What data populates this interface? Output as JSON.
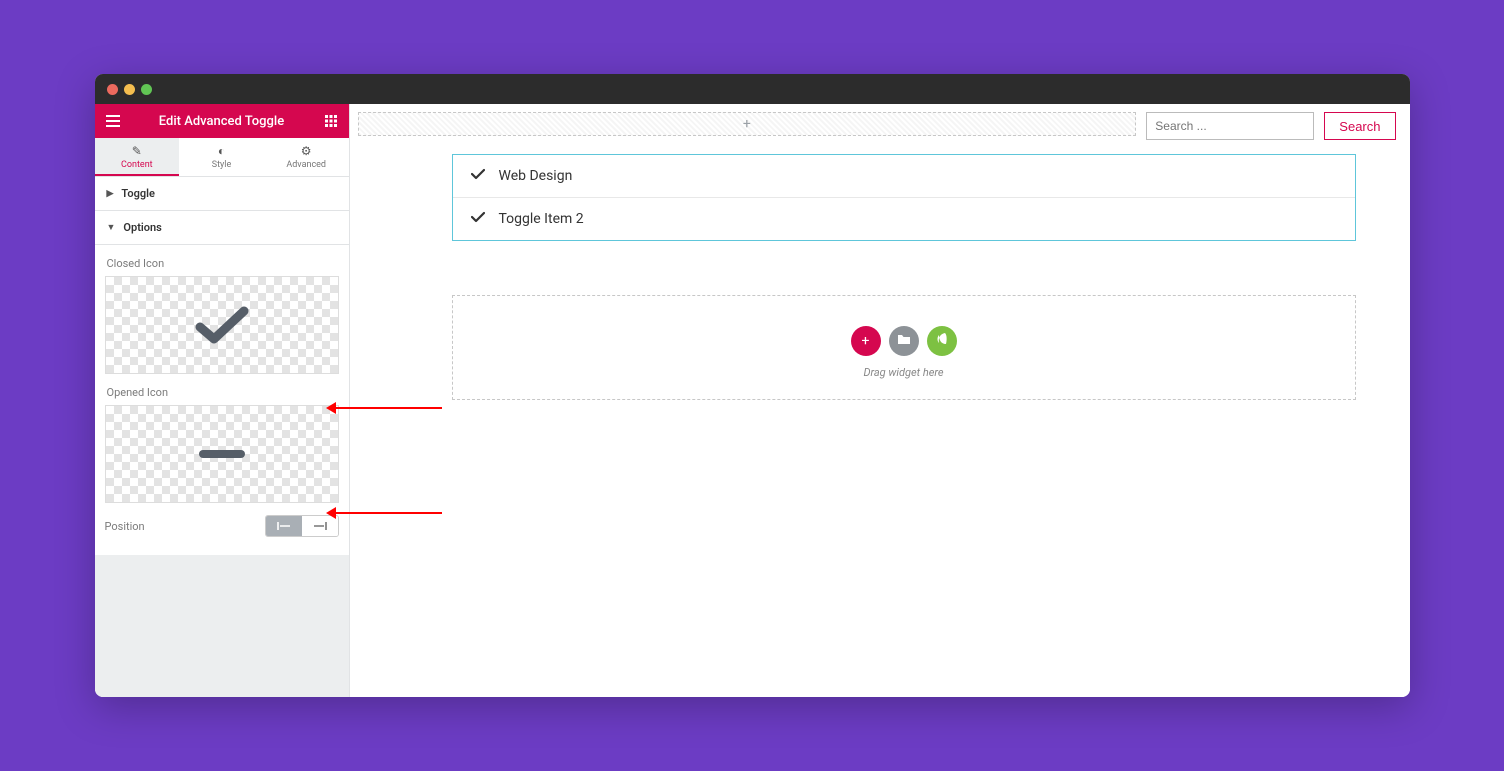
{
  "header": {
    "title": "Edit Advanced Toggle"
  },
  "tabs": {
    "content": "Content",
    "style": "Style",
    "advanced": "Advanced"
  },
  "accordion": {
    "toggle": "Toggle",
    "options": "Options"
  },
  "labels": {
    "closed_icon": "Closed Icon",
    "opened_icon": "Opened Icon",
    "position": "Position"
  },
  "search": {
    "placeholder": "Search ...",
    "button": "Search"
  },
  "toggle_items": [
    {
      "label": "Web Design"
    },
    {
      "label": "Toggle Item 2"
    }
  ],
  "dropzone": {
    "hint": "Drag widget here"
  }
}
